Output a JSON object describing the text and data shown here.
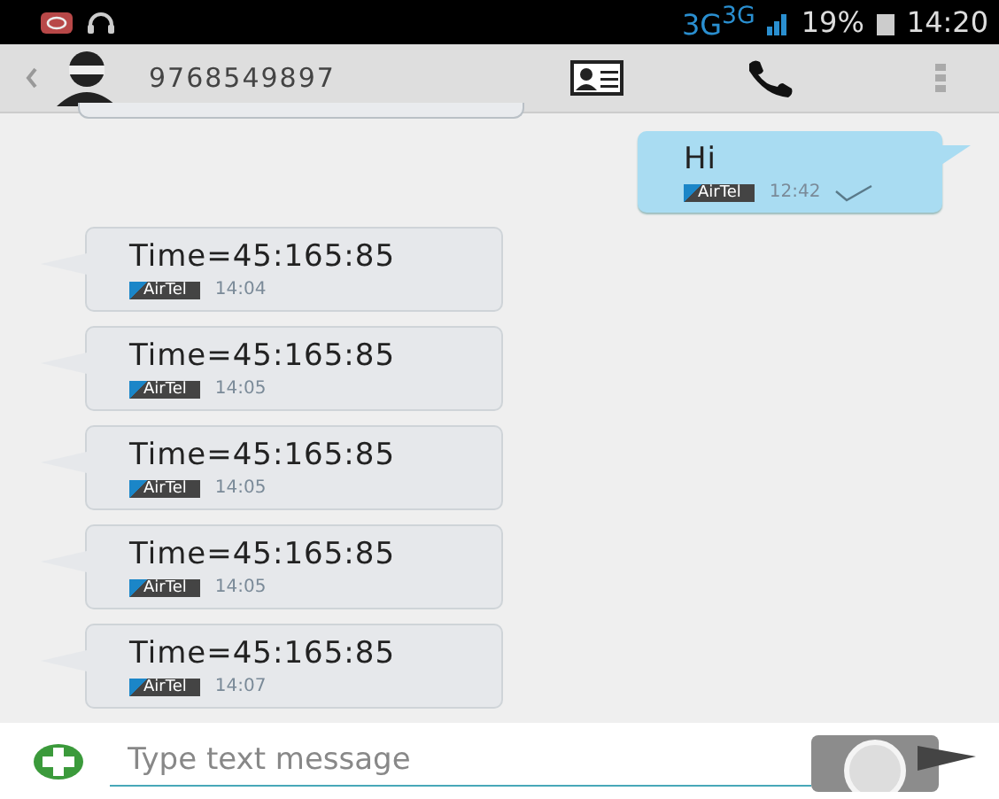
{
  "status_bar": {
    "network": "3G$^{3G}$",
    "battery": "19%",
    "time": "14:20"
  },
  "header": {
    "contact": "9768549897"
  },
  "messages": [
    {
      "kind": "outgoing",
      "text": "Hi",
      "carrier": "AirTel",
      "time": "12:42",
      "delivered": true
    },
    {
      "kind": "incoming",
      "text": "Time=45:165:85",
      "carrier": "AirTel",
      "time": "14:04"
    },
    {
      "kind": "incoming",
      "text": "Time=45:165:85",
      "carrier": "AirTel",
      "time": "14:05"
    },
    {
      "kind": "incoming",
      "text": "Time=45:165:85",
      "carrier": "AirTel",
      "time": "14:05"
    },
    {
      "kind": "incoming",
      "text": "Time=45:165:85",
      "carrier": "AirTel",
      "time": "14:05"
    },
    {
      "kind": "incoming",
      "text": "Time=45:165:85",
      "carrier": "AirTel",
      "time": "14:07"
    }
  ],
  "composer": {
    "placeholder": "Type text message"
  }
}
